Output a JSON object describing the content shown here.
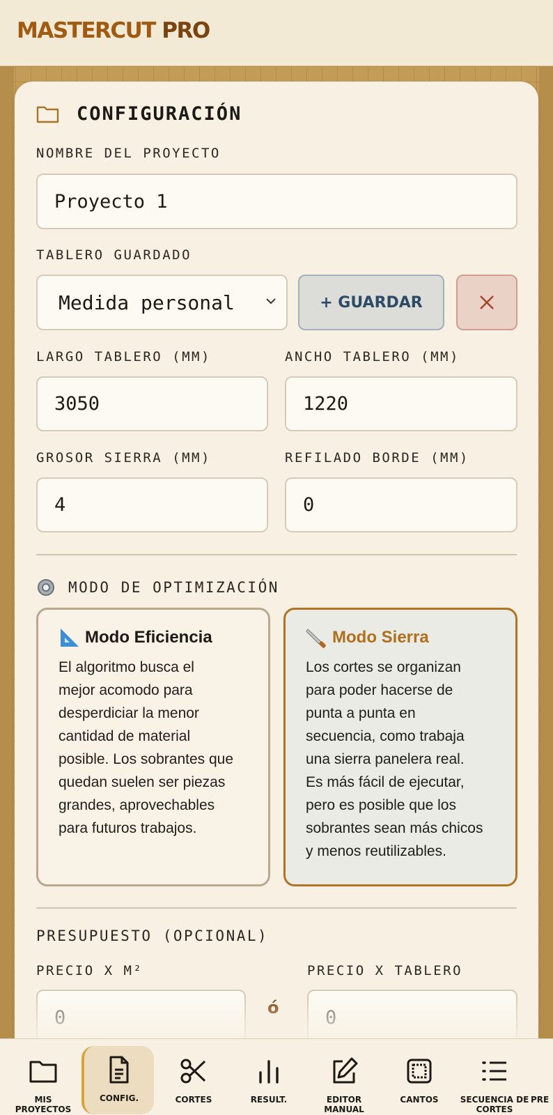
{
  "app": {
    "brand_main": "MASTERCUT",
    "brand_pro": " PRO"
  },
  "config": {
    "title": "CONFIGURACIÓN",
    "project_name_label": "NOMBRE DEL PROYECTO",
    "project_name_value": "Proyecto 1",
    "saved_board_label": "TABLERO GUARDADO",
    "saved_board_value": "Medida personal",
    "save_button_label": "+ GUARDAR",
    "board_length_label": "LARGO TABLERO (MM)",
    "board_length_value": "3050",
    "board_width_label": "ANCHO TABLERO (MM)",
    "board_width_value": "1220",
    "saw_thickness_label": "GROSOR SIERRA (MM)",
    "saw_thickness_value": "4",
    "edge_trim_label": "REFILADO BORDE (MM)",
    "edge_trim_value": "0"
  },
  "optimization": {
    "title": "MODO DE OPTIMIZACIÓN",
    "modes": [
      {
        "name": "Modo Eficiencia",
        "icon": "triangle-ruler-icon",
        "selected": false,
        "lines": [
          "El algoritmo busca el",
          "mejor acomodo para",
          "desperdiciar la menor",
          "cantidad de material",
          "posible. Los sobrantes que",
          "quedan suelen ser piezas",
          "grandes, aprovechables",
          "para futuros trabajos."
        ]
      },
      {
        "name": "Modo Sierra",
        "icon": "saw-icon",
        "selected": true,
        "lines": [
          "Los cortes se organizan",
          "para poder hacerse de",
          "punta a punta en",
          "secuencia, como trabaja",
          "una sierra panelera real.",
          "Es más fácil de ejecutar,",
          "pero es posible que los",
          "sobrantes sean más chicos",
          "y menos reutilizables."
        ]
      }
    ]
  },
  "budget": {
    "title": "PRESUPUESTO (OPCIONAL)",
    "price_m2_label": "PRECIO X M²",
    "price_m2_value": "0",
    "or_label": "ó",
    "price_board_label": "PRECIO X TABLERO",
    "price_board_value": "0"
  },
  "nav": [
    {
      "label": "MIS PROYECTOS",
      "icon": "folder-icon",
      "active": false
    },
    {
      "label": "CONFIG.",
      "icon": "document-icon",
      "active": true
    },
    {
      "label": "CORTES",
      "icon": "scissors-icon",
      "active": false
    },
    {
      "label": "RESULT.",
      "icon": "bar-chart-icon",
      "active": false
    },
    {
      "label": "EDITOR MANUAL",
      "icon": "edit-icon",
      "active": false
    },
    {
      "label": "CANTOS",
      "icon": "edge-square-icon",
      "active": false
    },
    {
      "label": "SECUENCIA DE CORTES",
      "icon": "list-icon",
      "active": false
    },
    {
      "label": "PRE",
      "icon": "",
      "active": false
    }
  ],
  "colors": {
    "brand": "#a05a12",
    "accent_border": "#b07424",
    "page_bg": "#f7f0e3",
    "board_bg": "#c49c57"
  }
}
